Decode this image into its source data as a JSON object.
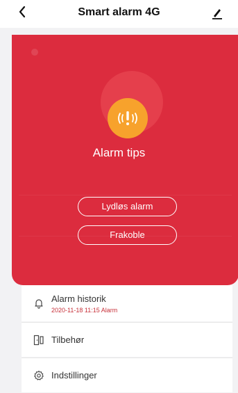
{
  "header": {
    "title": "Smart alarm 4G",
    "back_icon": "chevron-left-icon",
    "edit_icon": "pencil-icon"
  },
  "alarm": {
    "title": "Alarm tips",
    "icon": "alarm-warning-icon",
    "icon_color": "#f7a22c",
    "panel_color": "#dc2c3e",
    "buttons": {
      "silent": "Lydløs alarm",
      "disconnect": "Frakoble"
    }
  },
  "menu": {
    "history": {
      "label": "Alarm historik",
      "sub": "2020-11-18 11:15 Alarm"
    },
    "accessories": {
      "label": "Tilbehør"
    },
    "settings": {
      "label": "Indstillinger"
    }
  }
}
